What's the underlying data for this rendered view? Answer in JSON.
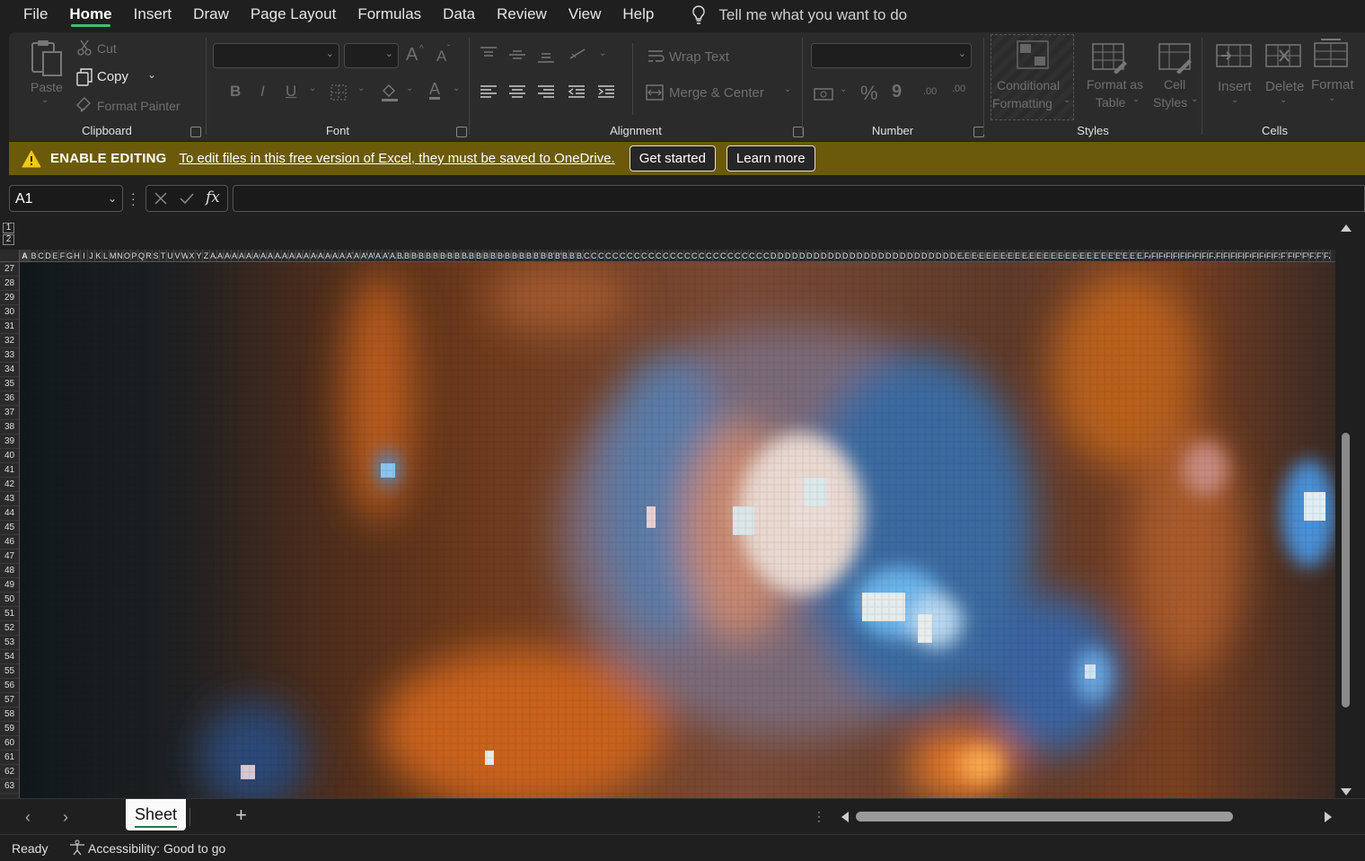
{
  "menu": {
    "items": [
      "File",
      "Home",
      "Insert",
      "Draw",
      "Page Layout",
      "Formulas",
      "Data",
      "Review",
      "View",
      "Help"
    ],
    "active": "Home",
    "tell_me": "Tell me what you want to do"
  },
  "ribbon": {
    "clipboard": {
      "label": "Clipboard",
      "paste": "Paste",
      "cut": "Cut",
      "copy": "Copy",
      "format_painter": "Format Painter"
    },
    "font": {
      "label": "Font",
      "bold": "B",
      "italic": "I",
      "underline": "U",
      "grow": "A",
      "shrink": "A",
      "font_color": "A"
    },
    "alignment": {
      "label": "Alignment",
      "wrap_text": "Wrap Text",
      "merge_center": "Merge & Center"
    },
    "number": {
      "label": "Number",
      "percent": "%",
      "comma": "9",
      "inc_dec": ".00",
      "dec_dec": ".00"
    },
    "styles": {
      "label": "Styles",
      "conditional_1": "Conditional",
      "conditional_2": "Formatting",
      "format_table_1": "Format as",
      "format_table_2": "Table",
      "cell_styles_1": "Cell",
      "cell_styles_2": "Styles"
    },
    "cells": {
      "label": "Cells",
      "insert": "Insert",
      "delete": "Delete",
      "format": "Format"
    }
  },
  "banner": {
    "title": "ENABLE EDITING",
    "message": "To edit files in this free version of Excel, they must be saved to OneDrive.",
    "get_started": "Get started",
    "learn_more": "Learn more",
    "color": "#6b5a0a"
  },
  "formula_bar": {
    "name_box": "A1",
    "fx": "fx",
    "value": ""
  },
  "grid": {
    "outline_levels": [
      "1",
      "2"
    ],
    "columns": [
      "A",
      "B",
      "C",
      "D",
      "E",
      "F",
      "G",
      "H",
      "I",
      "J",
      "K",
      "L",
      "M",
      "N",
      "O",
      "P",
      "Q",
      "R",
      "S",
      "T",
      "U",
      "V",
      "W",
      "X",
      "Y",
      "Z",
      "AA",
      "AB",
      "AC",
      "AD",
      "AE",
      "AF",
      "AG",
      "AH",
      "AI",
      "AJ",
      "AK",
      "AL",
      "AM",
      "AN",
      "AO",
      "AP",
      "AQ",
      "AR",
      "AS",
      "AT",
      "AU",
      "AV",
      "AW",
      "AX",
      "AY",
      "AZ",
      "BA",
      "BB",
      "BC",
      "BD",
      "BE",
      "BF",
      "BG",
      "BH",
      "BI",
      "BJ",
      "BK",
      "BL",
      "BM",
      "BN",
      "BO",
      "BP",
      "BQ",
      "BR",
      "BS",
      "BT",
      "BU",
      "BV",
      "BW",
      "BX",
      "BY",
      "BZ",
      "CA",
      "CB",
      "CC",
      "CD",
      "CE",
      "CF",
      "CG",
      "CH",
      "CI",
      "CJ",
      "CK",
      "CL",
      "CM",
      "CN",
      "CO",
      "CP",
      "CQ",
      "CR",
      "CS",
      "CT",
      "CU",
      "CV",
      "CW",
      "CX",
      "CY",
      "CZ",
      "DA",
      "DB",
      "DC",
      "DD",
      "DE",
      "DF",
      "DG",
      "DH",
      "DI",
      "DJ",
      "DK",
      "DL",
      "DM",
      "DN",
      "DO",
      "DP",
      "DQ",
      "DR",
      "DS",
      "DT",
      "DU",
      "DV",
      "DW",
      "DX",
      "DY",
      "DZ",
      "EA",
      "EB",
      "EC",
      "ED",
      "EE",
      "EF",
      "EG",
      "EH",
      "EI",
      "EJ",
      "EK",
      "EL",
      "EM",
      "EN",
      "EO",
      "EP",
      "EQ",
      "ER",
      "ES",
      "ET",
      "EU",
      "EV",
      "EW",
      "EX",
      "EY",
      "EZ",
      "FA",
      "FB",
      "FC",
      "FD",
      "FE",
      "FF",
      "FG",
      "FH",
      "FI",
      "FJ",
      "FK",
      "FL",
      "FM",
      "FN",
      "FO",
      "FP",
      "FQ",
      "FR",
      "FS",
      "FT",
      "FU",
      "FV",
      "FW",
      "FX",
      "FY",
      "FZ"
    ],
    "rows": [
      "27",
      "28",
      "29",
      "30",
      "31",
      "32",
      "33",
      "34",
      "35",
      "36",
      "37",
      "38",
      "39",
      "40",
      "41",
      "42",
      "43",
      "44",
      "45",
      "46",
      "47",
      "48",
      "49",
      "50",
      "51",
      "52",
      "53",
      "54",
      "55",
      "56",
      "57",
      "58",
      "59",
      "60",
      "61",
      "62",
      "63"
    ]
  },
  "sheet_tabs": {
    "active": "Sheet",
    "add": "+"
  },
  "status": {
    "ready": "Ready",
    "accessibility": "Accessibility: Good to go"
  }
}
